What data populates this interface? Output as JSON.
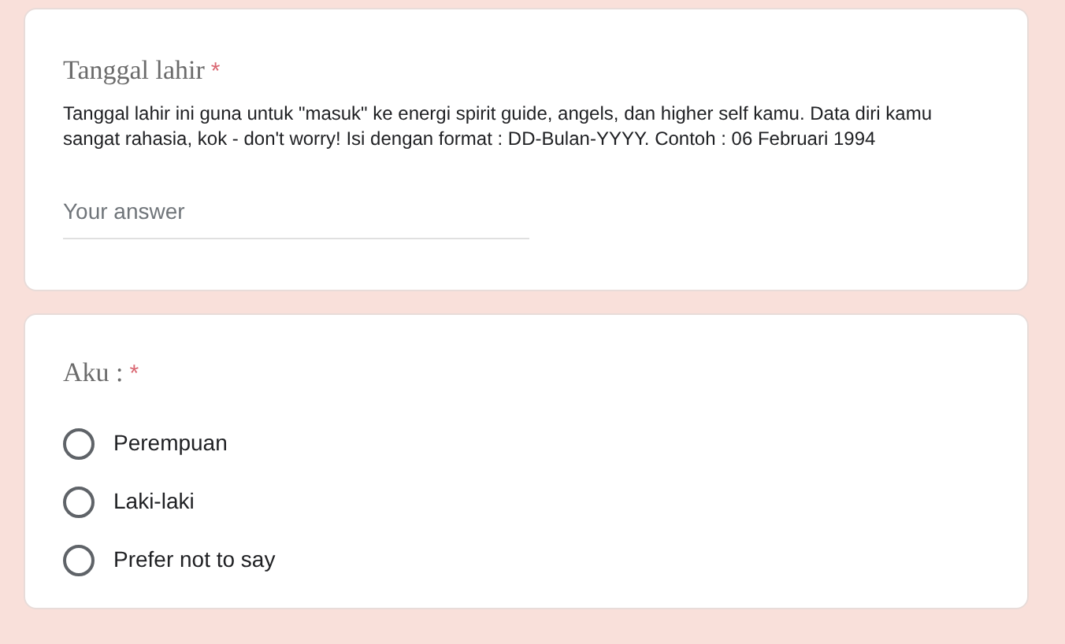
{
  "questions": [
    {
      "kind": "text",
      "title": "Tanggal lahir",
      "required_mark": "*",
      "description": "Tanggal lahir ini guna untuk \"masuk\" ke energi spirit guide, angels, dan higher self kamu. Data diri kamu sangat rahasia, kok - don't worry! Isi dengan format : DD-Bulan-YYYY. Contoh : 06 Februari 1994",
      "placeholder": "Your answer"
    },
    {
      "kind": "radio",
      "title": "Aku :",
      "required_mark": "*",
      "options": [
        {
          "label": "Perempuan",
          "selected": false
        },
        {
          "label": "Laki-laki",
          "selected": false
        },
        {
          "label": "Prefer not to say",
          "selected": false
        }
      ]
    }
  ]
}
